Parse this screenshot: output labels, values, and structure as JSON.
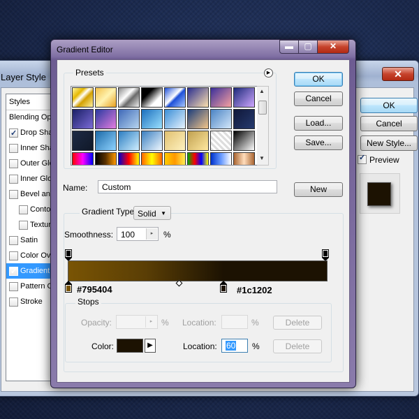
{
  "layer_style": {
    "title": "Layer Style",
    "close_symbol": "✕",
    "styles_header": "Styles",
    "items": [
      {
        "label": "Blending Options: Default",
        "checkbox": false,
        "checked": false,
        "indent": 0,
        "selected": false
      },
      {
        "label": "Drop Shadow",
        "checkbox": true,
        "checked": true,
        "indent": 0,
        "selected": false
      },
      {
        "label": "Inner Shadow",
        "checkbox": true,
        "checked": false,
        "indent": 0,
        "selected": false
      },
      {
        "label": "Outer Glow",
        "checkbox": true,
        "checked": false,
        "indent": 0,
        "selected": false
      },
      {
        "label": "Inner Glow",
        "checkbox": true,
        "checked": false,
        "indent": 0,
        "selected": false
      },
      {
        "label": "Bevel and Emboss",
        "checkbox": true,
        "checked": false,
        "indent": 0,
        "selected": false
      },
      {
        "label": "Contour",
        "checkbox": true,
        "checked": false,
        "indent": 1,
        "selected": false
      },
      {
        "label": "Texture",
        "checkbox": true,
        "checked": false,
        "indent": 1,
        "selected": false
      },
      {
        "label": "Satin",
        "checkbox": true,
        "checked": false,
        "indent": 0,
        "selected": false
      },
      {
        "label": "Color Overlay",
        "checkbox": true,
        "checked": false,
        "indent": 0,
        "selected": false
      },
      {
        "label": "Gradient Overlay",
        "checkbox": true,
        "checked": true,
        "indent": 0,
        "selected": true
      },
      {
        "label": "Pattern Overlay",
        "checkbox": true,
        "checked": false,
        "indent": 0,
        "selected": false
      },
      {
        "label": "Stroke",
        "checkbox": true,
        "checked": false,
        "indent": 0,
        "selected": false
      }
    ],
    "ok_label": "OK",
    "cancel_label": "Cancel",
    "new_style_label": "New Style...",
    "preview_label": "Preview",
    "preview_checked": true,
    "preview_color": "#1c1202"
  },
  "gradient_editor": {
    "title": "Gradient Editor",
    "window_controls": {
      "minimize": "▬",
      "maximize": "▢",
      "close": "✕"
    },
    "presets": {
      "label": "Presets",
      "menu_icon": "▶",
      "scroll_up": "▲",
      "scroll_down": "▼",
      "swatches": [
        "linear-gradient(135deg,#fff6a0,#e6b800 30%,#fff 45%,#d4a000 60%,#fff2a0)",
        "linear-gradient(135deg,#f3c04a,#fff3b0 50%,#e8a020)",
        "linear-gradient(135deg,#8a8a8a,#fff 40%,#6a6a6a 60%,#f0f0f0)",
        "linear-gradient(135deg,#000 30%,#fff 70%)",
        "linear-gradient(135deg,#1d4fd8,#fff 45%,#1d4fd8 55%,#a8c8ff)",
        "linear-gradient(135deg,#2b2f8f,#fde1b0)",
        "linear-gradient(135deg,#3a2f9a,#f7a1a1)",
        "linear-gradient(135deg,#1d2a7a,#cfa7ff)",
        "linear-gradient(135deg,#1a1f66,#7b6bd6)",
        "linear-gradient(135deg,#2a3aa0,#e47de0)",
        "linear-gradient(135deg,#3f69b8,#b7d6f0)",
        "linear-gradient(135deg,#1b6fbd,#9be0ff)",
        "linear-gradient(135deg,#3b8fd6,#e7f3ff)",
        "linear-gradient(135deg,#1c3d7a,#f4c68a)",
        "linear-gradient(135deg,#4b84c4,#d3e7fa)",
        "linear-gradient(135deg,#10183a,#263a6e)",
        "linear-gradient(135deg,#1d2a45,#101828)",
        "linear-gradient(135deg,#1c6aa8,#8fd3ff)",
        "linear-gradient(135deg,#2b7dc1,#cfeeff)",
        "linear-gradient(135deg,#3a7fc0,#f0f8ff)",
        "linear-gradient(135deg,#e0c070,#fff2c0)",
        "linear-gradient(135deg,#c0a050,#ffe8a0)",
        "repeating-linear-gradient(45deg,#ddd 0 3px,#fff 3px 6px)",
        "linear-gradient(135deg,#000,#fff)",
        "linear-gradient(90deg,#ff0000,#ff00ff,#0000ff)",
        "linear-gradient(90deg,#000,#5a3200,#ff9900)",
        "linear-gradient(90deg,#0000cc,#ff0000,#ffff00)",
        "linear-gradient(90deg,#ff6600,#ffff00,#ff6600)",
        "linear-gradient(90deg,#ffcc00,#ff9900,#ffee55)",
        "linear-gradient(90deg,#00aa00,#ff0000,#0000ff,#ffff00)",
        "linear-gradient(90deg,#0033cc,#6699ff,#ffffff)",
        "linear-gradient(90deg,#aa6633,#ffddbb,#aa6633)"
      ]
    },
    "buttons": {
      "ok": "OK",
      "cancel": "Cancel",
      "load": "Load...",
      "save": "Save...",
      "new": "New"
    },
    "name": {
      "label": "Name:",
      "value": "Custom"
    },
    "gradient_type": {
      "label": "Gradient Type:",
      "value": "Solid",
      "dropdown_icon": "▼"
    },
    "smoothness": {
      "label": "Smoothness:",
      "value": "100",
      "unit": "%",
      "spin_icon": "▸"
    },
    "gradient": {
      "start_color": "#795404",
      "end_color": "#1c1202",
      "color_stops": [
        {
          "color": "#795404",
          "location": 0
        },
        {
          "color": "#1c1202",
          "location": 60
        }
      ],
      "opacity_stops": [
        0,
        100
      ],
      "midpoint": 50,
      "left_hex": "#795404",
      "right_hex": "#1c1202"
    },
    "stops": {
      "label": "Stops",
      "opacity_label": "Opacity:",
      "opacity_unit": "%",
      "location_label": "Location:",
      "location_unit": "%",
      "delete_label": "Delete",
      "color_label": "Color:",
      "color_value": "#1c1202",
      "color_arrow": "▶",
      "location_value": "60"
    }
  }
}
